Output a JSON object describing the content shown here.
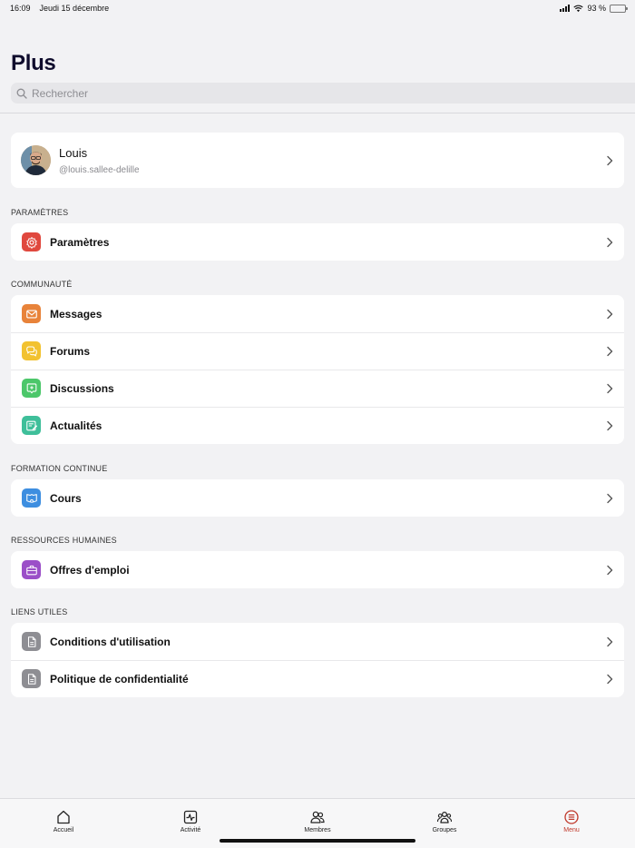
{
  "status_bar": {
    "time": "16:09",
    "date": "Jeudi 15 décembre",
    "battery": "93 %"
  },
  "header": {
    "title": "Plus",
    "search_placeholder": "Rechercher"
  },
  "profile": {
    "name": "Louis",
    "handle": "@louis.sallee-delille"
  },
  "sections": [
    {
      "title": "PARAMÈTRES",
      "items": [
        {
          "label": "Paramètres",
          "icon": "settings-icon",
          "color": "#e0483e"
        }
      ]
    },
    {
      "title": "COMMUNAUTÉ",
      "items": [
        {
          "label": "Messages",
          "icon": "mail-icon",
          "color": "#e8833a"
        },
        {
          "label": "Forums",
          "icon": "chat-bubbles-icon",
          "color": "#f2c230"
        },
        {
          "label": "Discussions",
          "icon": "discussion-icon",
          "color": "#4cc76a"
        },
        {
          "label": "Actualités",
          "icon": "news-icon",
          "color": "#3fbf9a"
        }
      ]
    },
    {
      "title": "FORMATION CONTINUE",
      "items": [
        {
          "label": "Cours",
          "icon": "course-icon",
          "color": "#3d8ee0"
        }
      ]
    },
    {
      "title": "RESSOURCES HUMAINES",
      "items": [
        {
          "label": "Offres d'emploi",
          "icon": "briefcase-icon",
          "color": "#9b4fc8"
        }
      ]
    },
    {
      "title": "LIENS UTILES",
      "items": [
        {
          "label": "Conditions d'utilisation",
          "icon": "document-icon",
          "color": "#8e8e93"
        },
        {
          "label": "Politique de confidentialité",
          "icon": "document-icon",
          "color": "#8e8e93"
        }
      ]
    }
  ],
  "tab_bar": {
    "tabs": [
      {
        "label": "Accueil",
        "icon": "home-icon"
      },
      {
        "label": "Activité",
        "icon": "activity-icon"
      },
      {
        "label": "Membres",
        "icon": "members-icon"
      },
      {
        "label": "Groupes",
        "icon": "groups-icon"
      },
      {
        "label": "Menu",
        "icon": "menu-icon"
      }
    ],
    "active": "Menu",
    "active_color": "#c0392b"
  }
}
